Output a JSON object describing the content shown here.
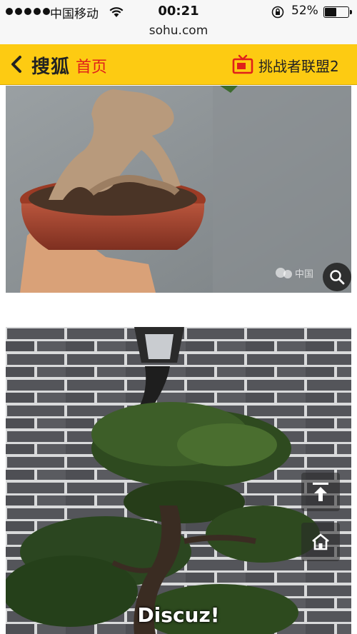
{
  "status_bar": {
    "carrier": "中国移动",
    "time": "00:21",
    "battery_percent_label": "52%",
    "battery_level": 0.52
  },
  "url_bar": {
    "domain": "sohu.com"
  },
  "header": {
    "brand": "搜狐",
    "home_link": "首页",
    "channel": "挑战者联盟2",
    "colors": {
      "background": "#fdcb12",
      "home_link": "#e0201a"
    }
  },
  "images": [
    {
      "subject": "bonsai in terracotta pot held in hand",
      "watermark": "中国"
    },
    {
      "subject": "pine bonsai in front of grey brick wall with lamp"
    }
  ],
  "floating_buttons": {
    "top_icon": "back-to-top-icon",
    "home_icon": "home-icon"
  },
  "zoom_icon": "magnifier-icon",
  "footer_watermark": "Discuz!"
}
